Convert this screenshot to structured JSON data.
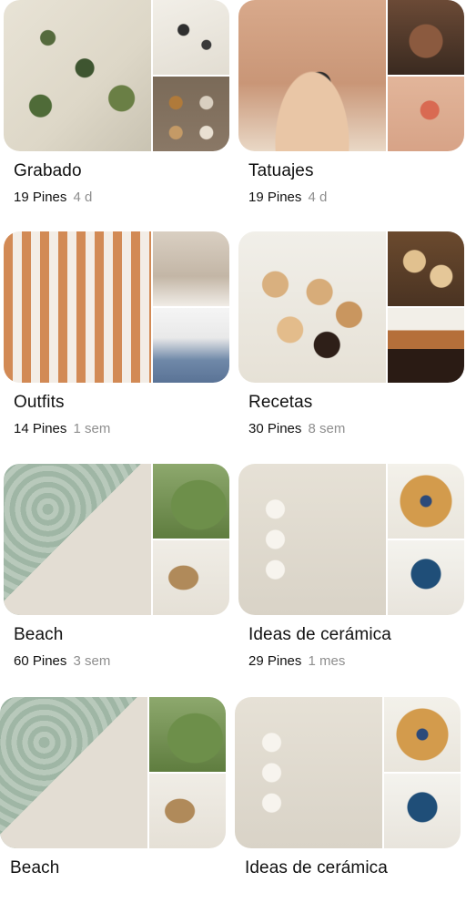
{
  "boards": [
    {
      "title": "Grabado",
      "pins": "19 Pines",
      "age": "4 d",
      "images": {
        "main": "linocut botanical print",
        "top": "black leaf sketches",
        "bottom": "mushroom and plant stamps"
      }
    },
    {
      "title": "Tatuajes",
      "pins": "19 Pines",
      "age": "4 d",
      "images": {
        "main": "shell tattoo on arm",
        "top": "back tattoo",
        "bottom": "red floral tattoo"
      }
    },
    {
      "title": "Outfits",
      "pins": "14 Pines",
      "age": "1 sem",
      "images": {
        "main": "striped matching set",
        "top": "beige top outfit",
        "bottom": "white shirt and jeans"
      }
    },
    {
      "title": "Recetas",
      "pins": "30 Pines",
      "age": "8 sem",
      "images": {
        "main": "chocolate dipped cookies",
        "top": "pistachio cookies",
        "bottom": "layered alfajor"
      }
    },
    {
      "title": "Beach",
      "pins": "60 Pines",
      "age": "3 sem",
      "images": {
        "main": "poolside coffee cup",
        "top": "tropical leaves",
        "bottom": "straw hat and notebook"
      }
    },
    {
      "title": "Ideas de cerámica",
      "pins": "29 Pines",
      "age": "1 mes",
      "images": {
        "main": "ceramic paint palette",
        "top": "ceramic dish with tiles",
        "bottom": "whale tail ceramic bowl"
      }
    },
    {
      "title": "Beach",
      "pins": "",
      "age": "",
      "images": {
        "main": "poolside coffee cup",
        "top": "tropical leaves",
        "bottom": "straw hat and notebook"
      }
    },
    {
      "title": "Ideas de cerámica",
      "pins": "",
      "age": "",
      "images": {
        "main": "ceramic paint palette",
        "top": "ceramic dish with tiles",
        "bottom": "whale tail ceramic bowl"
      }
    }
  ]
}
